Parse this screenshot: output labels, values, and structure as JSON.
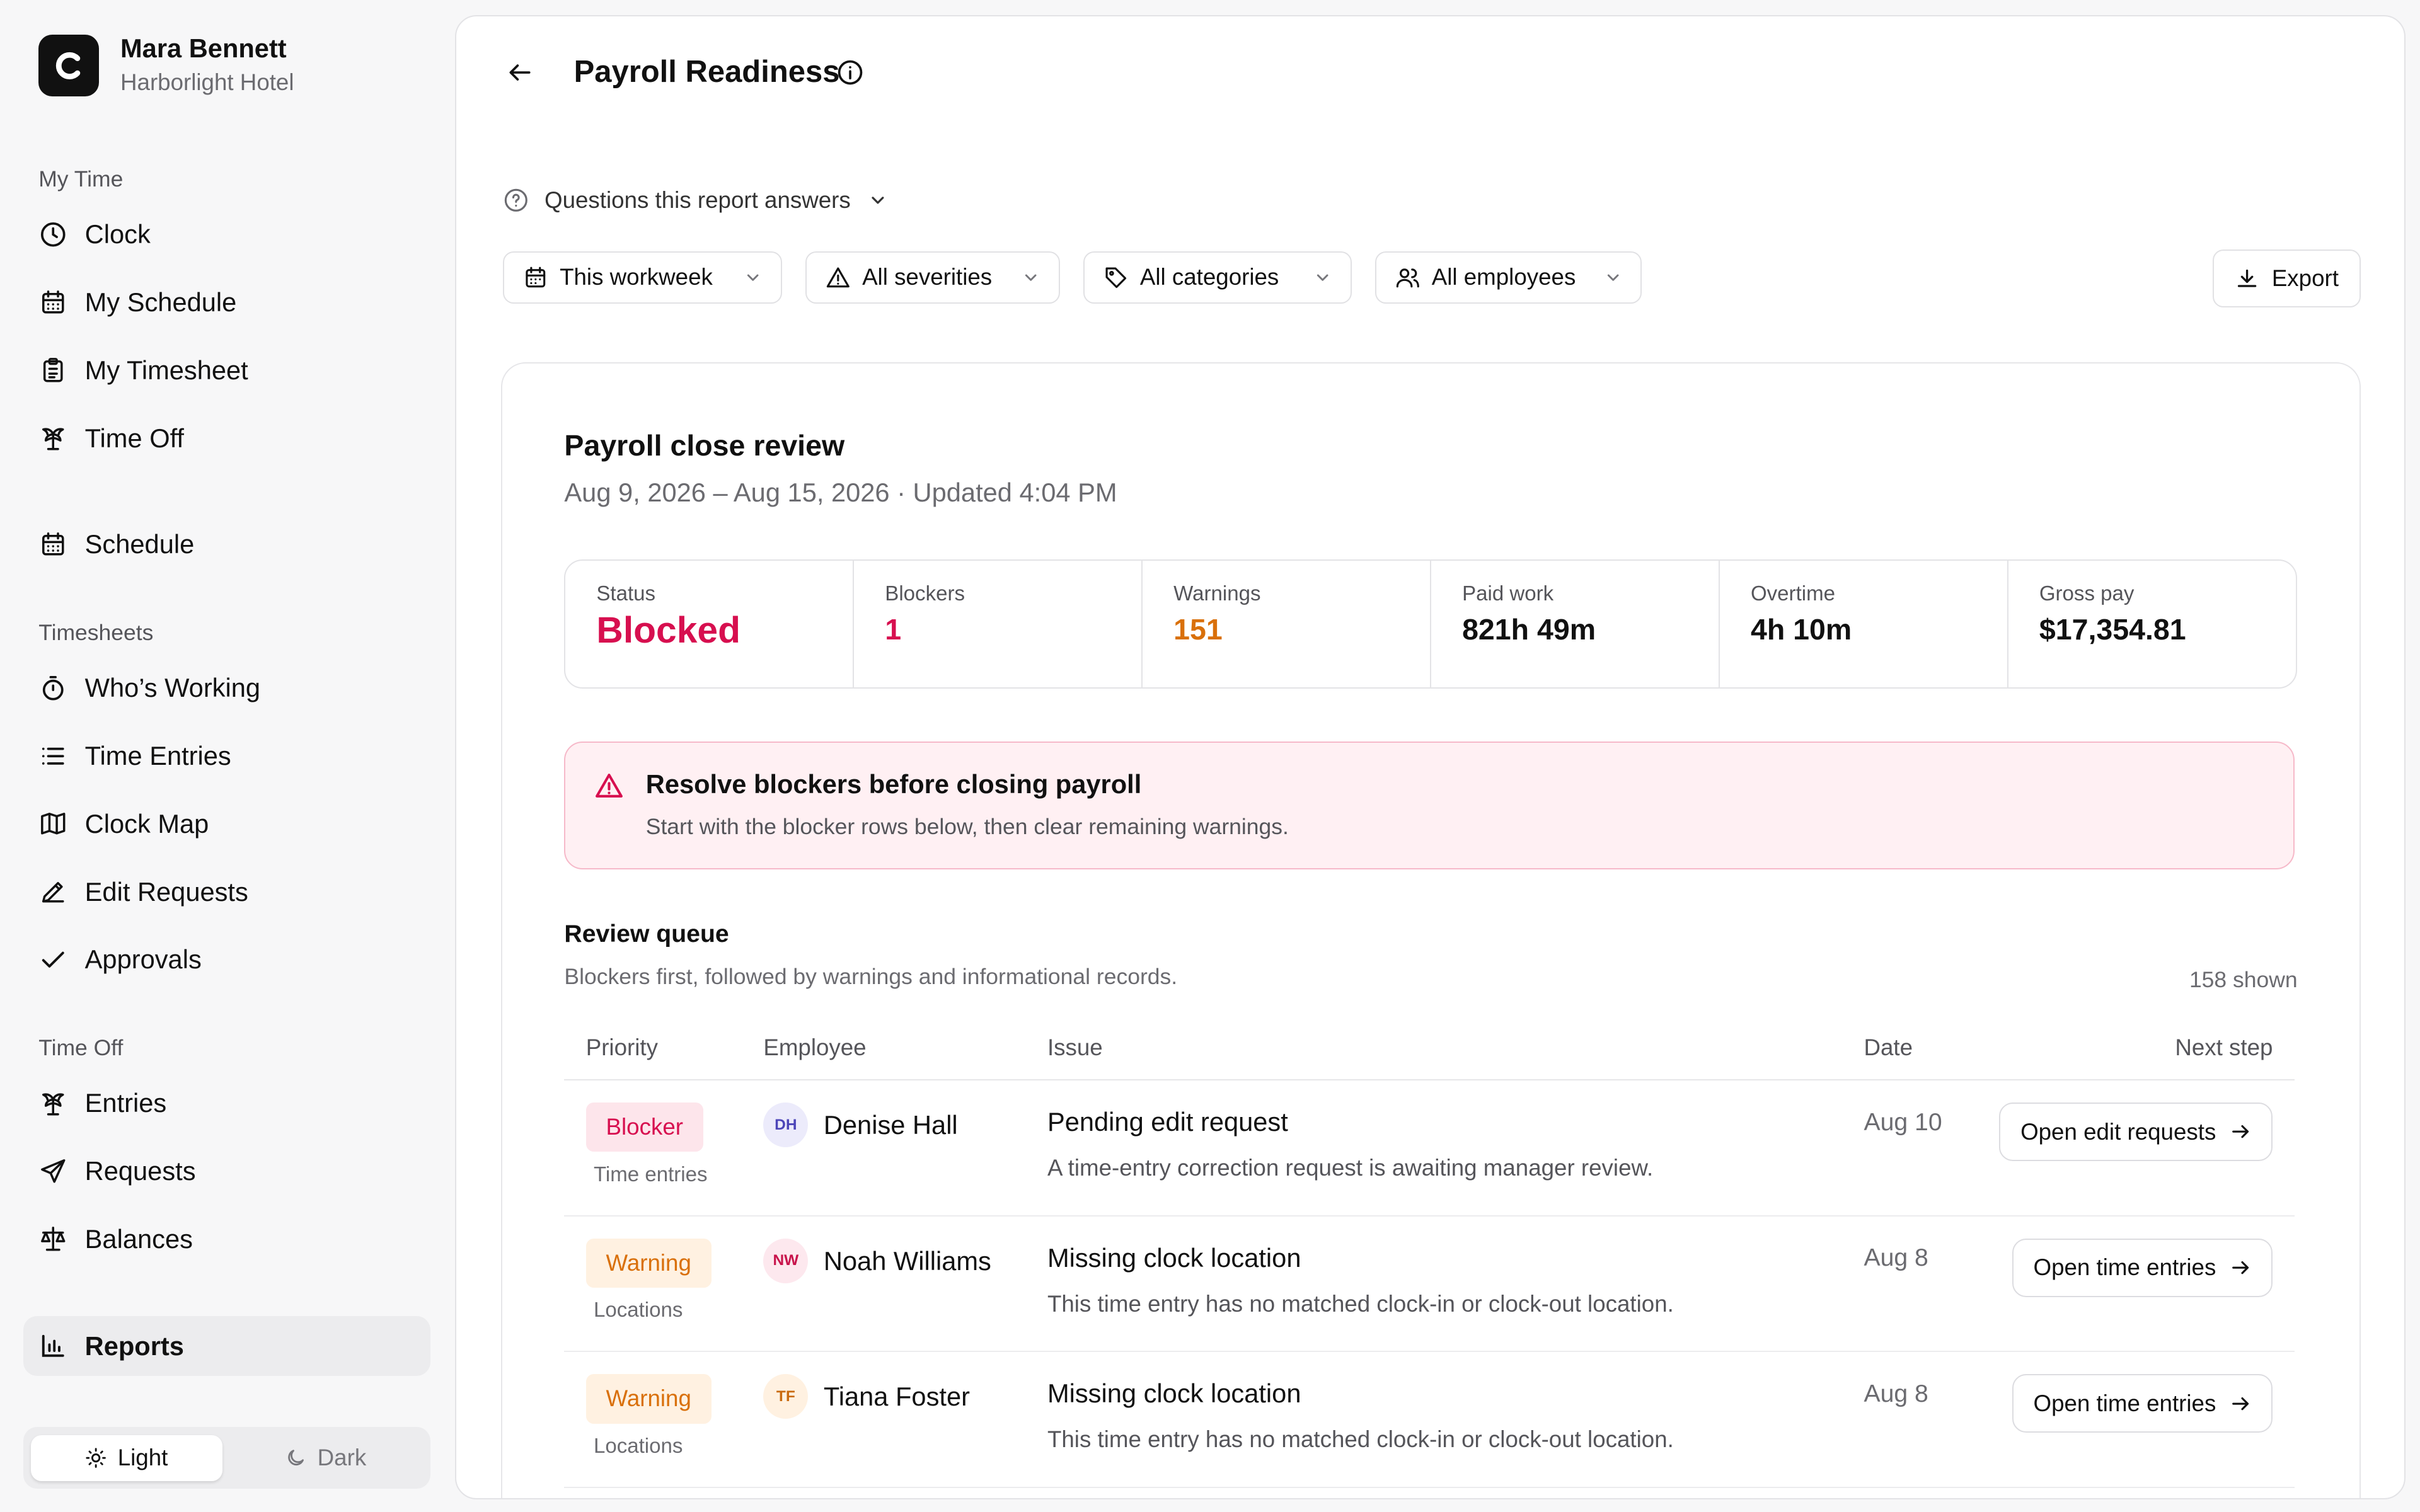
{
  "user": {
    "name": "Mara Bennett",
    "org": "Harborlight Hotel"
  },
  "sidebar": {
    "sections": {
      "my_time": "My Time",
      "timesheets": "Timesheets",
      "time_off": "Time Off"
    },
    "items": {
      "clock": "Clock",
      "my_schedule": "My Schedule",
      "my_timesheet": "My Timesheet",
      "time_off": "Time Off",
      "schedule": "Schedule",
      "whos_working": "Who’s Working",
      "time_entries": "Time Entries",
      "clock_map": "Clock Map",
      "edit_requests": "Edit Requests",
      "approvals": "Approvals",
      "entries": "Entries",
      "requests": "Requests",
      "balances": "Balances",
      "reports": "Reports"
    },
    "active": "reports",
    "theme": {
      "light": "Light",
      "dark": "Dark",
      "selected": "light"
    }
  },
  "page": {
    "title": "Payroll Readiness",
    "questions_label": "Questions this report answers",
    "filters": {
      "period": "This workweek",
      "severity": "All severities",
      "category": "All categories",
      "employees": "All employees"
    },
    "export_label": "Export"
  },
  "review": {
    "title": "Payroll close review",
    "subtitle": "Aug 9, 2026 – Aug 15, 2026 · Updated 4:04 PM",
    "stats": {
      "status": {
        "label": "Status",
        "value": "Blocked"
      },
      "blockers": {
        "label": "Blockers",
        "value": "1"
      },
      "warnings": {
        "label": "Warnings",
        "value": "151"
      },
      "paid_work": {
        "label": "Paid work",
        "value": "821h 49m"
      },
      "overtime": {
        "label": "Overtime",
        "value": "4h 10m"
      },
      "gross_pay": {
        "label": "Gross pay",
        "value": "$17,354.81"
      }
    },
    "alert": {
      "title": "Resolve blockers before closing payroll",
      "text": "Start with the blocker rows below, then clear remaining warnings."
    }
  },
  "queue": {
    "title": "Review queue",
    "subtitle": "Blockers first, followed by warnings and informational records.",
    "count": "158 shown",
    "columns": {
      "priority": "Priority",
      "employee": "Employee",
      "issue": "Issue",
      "date": "Date",
      "next_step": "Next step"
    },
    "rows": [
      {
        "priority": "Blocker",
        "category": "Time entries",
        "initials": "DH",
        "employee": "Denise Hall",
        "issue": "Pending edit request",
        "detail": "A time-entry correction request is awaiting manager review.",
        "date": "Aug 10",
        "action": "Open edit requests"
      },
      {
        "priority": "Warning",
        "category": "Locations",
        "initials": "NW",
        "employee": "Noah Williams",
        "issue": "Missing clock location",
        "detail": "This time entry has no matched clock-in or clock-out location.",
        "date": "Aug 8",
        "action": "Open time entries"
      },
      {
        "priority": "Warning",
        "category": "Locations",
        "initials": "TF",
        "employee": "Tiana Foster",
        "issue": "Missing clock location",
        "detail": "This time entry has no matched clock-in or clock-out location.",
        "date": "Aug 8",
        "action": "Open time entries"
      }
    ]
  },
  "colors": {
    "blocker": "#d70f4f",
    "warning": "#d9700b",
    "alert_bg": "#fff0f3",
    "alert_border": "#f6b9c9"
  },
  "icons": {
    "logo": "c-logo-icon",
    "back": "arrow-left-icon",
    "title_info": "info-icon",
    "questions": "help-circle-icon",
    "export": "download-icon",
    "alert": "warning-triangle-icon"
  }
}
